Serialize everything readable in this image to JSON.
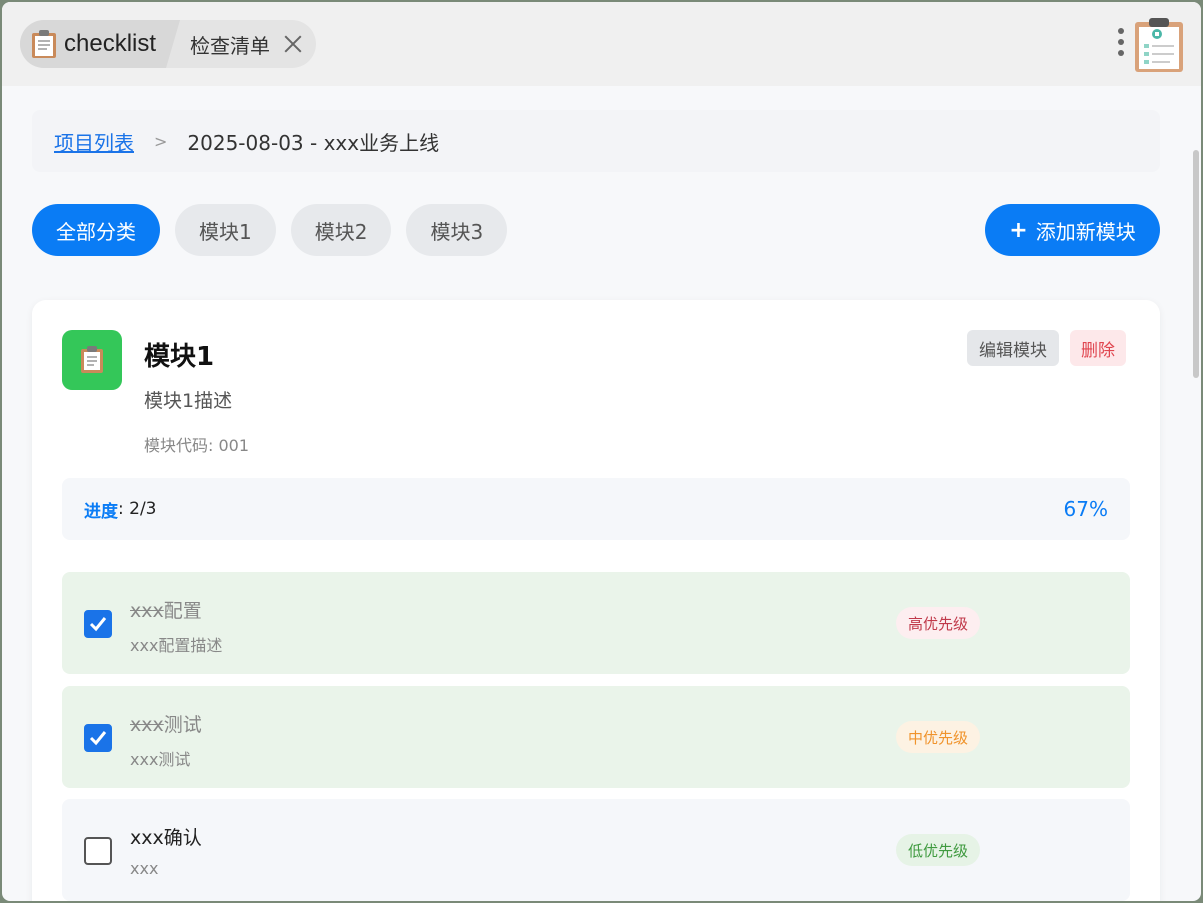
{
  "titlebar": {
    "app_tab_label": "checklist",
    "page_tab_label": "检查清单"
  },
  "breadcrumb": {
    "link": "项目列表",
    "separator": ">",
    "current": "2025-08-03 - xxx业务上线"
  },
  "filters": [
    "全部分类",
    "模块1",
    "模块2",
    "模块3"
  ],
  "add_module_label": "添加新模块",
  "module": {
    "title": "模块1",
    "description": "模块1描述",
    "code": "模块代码: 001",
    "edit_label": "编辑模块",
    "delete_label": "删除",
    "progress_label": "进度",
    "progress_value": ": 2/3",
    "progress_percent": "67%",
    "progress_fraction": 0.67
  },
  "tasks": [
    {
      "title_strike": "xxx",
      "title_rest": "配置",
      "subtitle": "xxx配置描述",
      "priority": "高优先级",
      "done": true
    },
    {
      "title_strike": "xxx",
      "title_rest": "测试",
      "subtitle": "xxx测试",
      "priority": "中优先级",
      "done": true
    },
    {
      "title_strike": "",
      "title_rest": "xxx确认",
      "subtitle": "xxx",
      "priority": "低优先级",
      "done": false
    }
  ],
  "colors": {
    "accent": "#0a7cf5",
    "module_icon_bg": "#34c759",
    "done_bg": "#eaf4ea",
    "high_priority": "#e0454f",
    "medium_priority": "#f0932b",
    "low_priority": "#3f9a3f"
  },
  "icons": {
    "app": "clipboard-icon",
    "close": "close-icon",
    "menu": "more-vertical-icon",
    "module": "clipboard-icon",
    "check": "checkmark-icon"
  }
}
